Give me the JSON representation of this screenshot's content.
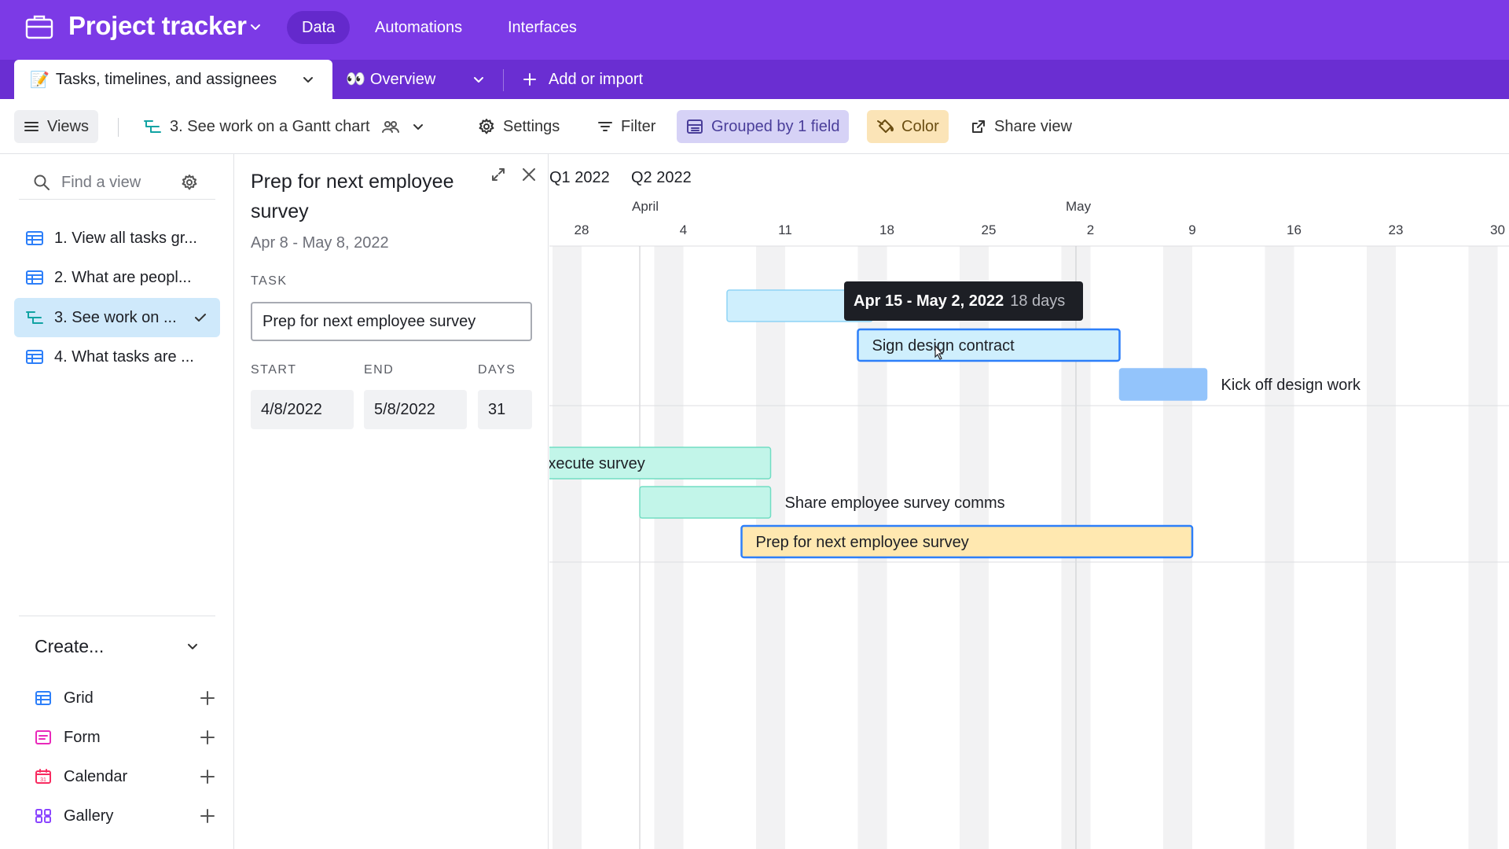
{
  "app": {
    "title": "Project tracker",
    "accent": "#7c3ae6",
    "nav": [
      "Data",
      "Automations",
      "Interfaces"
    ]
  },
  "tabs": {
    "active_emoji": "📝",
    "active": "Tasks, timelines, and assignees",
    "overview_emoji": "👀",
    "overview": "Overview",
    "add": "Add or import"
  },
  "viewbar": {
    "views": "Views",
    "current": "3. See work on a Gantt chart",
    "settings": "Settings",
    "filter": "Filter",
    "grouped": "Grouped by 1 field",
    "color": "Color",
    "share": "Share view"
  },
  "sidebar": {
    "search_placeholder": "Find a view",
    "views": [
      {
        "label": "1. View all tasks gr...",
        "icon": "grid-view-icon"
      },
      {
        "label": "2. What are peopl...",
        "icon": "grid-view-icon"
      },
      {
        "label": "3. See work on ...",
        "icon": "gantt-view-icon",
        "active": true
      },
      {
        "label": "4. What tasks are ...",
        "icon": "grid-view-icon"
      }
    ],
    "create_title": "Create...",
    "create_items": [
      {
        "label": "Grid",
        "icon": "grid-icon",
        "color": "#2d7ff9"
      },
      {
        "label": "Form",
        "icon": "form-icon",
        "color": "#e929ba"
      },
      {
        "label": "Calendar",
        "icon": "calendar-icon",
        "color": "#f82b60"
      },
      {
        "label": "Gallery",
        "icon": "gallery-icon",
        "color": "#8b46ff"
      }
    ]
  },
  "detail": {
    "title": "Prep for next employee survey",
    "range": "Apr 8 - May 8, 2022",
    "task_label": "TASK",
    "task_value": "Prep for next employee survey",
    "start_label": "START",
    "end_label": "END",
    "days_label": "DAYS",
    "start": "4/8/2022",
    "end": "5/8/2022",
    "days": "31"
  },
  "gantt": {
    "quarters": [
      "Q1 2022",
      "Q2 2022"
    ],
    "months": [
      "April",
      "May"
    ],
    "weeks": [
      "28",
      "4",
      "11",
      "18",
      "25",
      "2",
      "9",
      "16",
      "23",
      "30"
    ],
    "tooltip": {
      "range": "Apr 15 - May 2, 2022",
      "days": "18 days"
    },
    "bars": [
      {
        "label": "",
        "start": "2022-04-07",
        "end": "2022-04-17",
        "color": "#cfeffd",
        "border": "#8fd3f5"
      },
      {
        "label": "Sign design contract",
        "start": "2022-04-16",
        "end": "2022-05-04",
        "color": "#cfeffd",
        "border": "#2d7ff9",
        "selected": true
      },
      {
        "label": "Kick off design work",
        "start": "2022-05-04",
        "end": "2022-05-10",
        "color": "#93c4fb",
        "border": "#93c4fb",
        "label_outside": true
      },
      {
        "label": "Execute survey",
        "start": "2022-03-24",
        "end": "2022-04-10",
        "color": "#c2f5e9",
        "border": "#72ddc3"
      },
      {
        "label": "Share employee survey comms",
        "start": "2022-04-01",
        "end": "2022-04-10",
        "color": "#c2f5e9",
        "border": "#72ddc3",
        "label_outside": true
      },
      {
        "label": "Prep for next employee survey",
        "start": "2022-04-08",
        "end": "2022-05-09",
        "color": "#ffe8b0",
        "border": "#2d7ff9",
        "selected": true
      }
    ]
  }
}
